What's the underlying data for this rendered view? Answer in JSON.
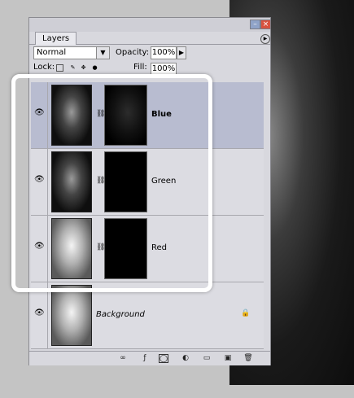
{
  "panel": {
    "tab_label": "Layers",
    "blend_mode": "Normal",
    "opacity_label": "Opacity:",
    "opacity_value": "100%",
    "lock_label": "Lock:",
    "fill_label": "Fill:",
    "fill_value": "100%"
  },
  "layers": [
    {
      "name": "Blue",
      "selected": true,
      "style": "bold"
    },
    {
      "name": "Green",
      "selected": false,
      "style": "normal"
    },
    {
      "name": "Red",
      "selected": false,
      "style": "normal"
    },
    {
      "name": "Background",
      "selected": false,
      "style": "italic",
      "locked": true
    }
  ],
  "icons": {
    "eye": "eye-icon",
    "chain": "chain-link-icon",
    "lock": "lock-icon",
    "menu": "panel-menu-icon",
    "link_layers": "link-layers-icon",
    "layer_style": "layer-style-icon",
    "add_mask": "add-mask-icon",
    "adjustment": "adjustment-layer-icon",
    "new_group": "new-group-icon",
    "new_layer": "new-layer-icon",
    "delete": "trash-icon"
  },
  "colors": {
    "panel_bg": "#d8d8de",
    "selected_row": "#b8bcd0",
    "close_button": "#d7523f",
    "highlight_frame": "#ffffff"
  }
}
